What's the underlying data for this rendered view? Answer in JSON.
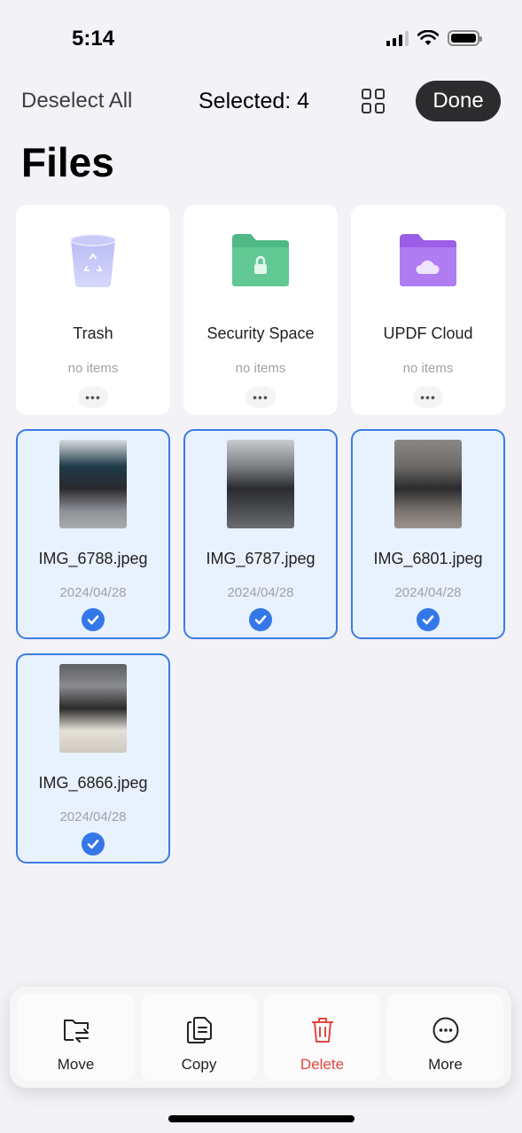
{
  "status_bar": {
    "time": "5:14"
  },
  "toolbar": {
    "deselect_label": "Deselect All",
    "selected_label": "Selected: 4",
    "done_label": "Done"
  },
  "page": {
    "title": "Files"
  },
  "folders": [
    {
      "name": "Trash",
      "count": "no items",
      "icon": "trash-icon"
    },
    {
      "name": "Security Space",
      "count": "no items",
      "icon": "lock-folder-icon"
    },
    {
      "name": "UPDF Cloud",
      "count": "no items",
      "icon": "cloud-folder-icon"
    }
  ],
  "files": [
    {
      "name": "IMG_6788.jpeg",
      "date": "2024/04/28",
      "selected": true
    },
    {
      "name": "IMG_6787.jpeg",
      "date": "2024/04/28",
      "selected": true
    },
    {
      "name": "IMG_6801.jpeg",
      "date": "2024/04/28",
      "selected": true
    },
    {
      "name": "IMG_6866.jpeg",
      "date": "2024/04/28",
      "selected": true
    }
  ],
  "actions": [
    {
      "label": "Move",
      "icon": "move-folder-icon"
    },
    {
      "label": "Copy",
      "icon": "copy-icon"
    },
    {
      "label": "Delete",
      "icon": "trash-icon"
    },
    {
      "label": "More",
      "icon": "more-icon"
    }
  ],
  "colors": {
    "accent": "#3478e8",
    "selected_bg": "#e8f1fe",
    "delete": "#e0473c",
    "done_bg": "#2c2c2e"
  }
}
